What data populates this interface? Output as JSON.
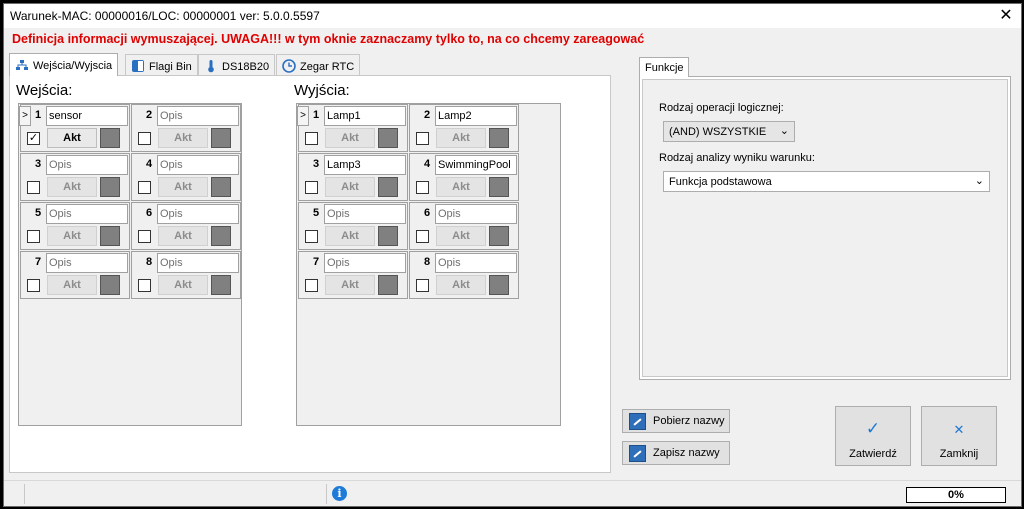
{
  "window": {
    "title": "Warunek-MAC: 00000016/LOC: 00000001 ver: 5.0.0.5597",
    "close_glyph": "✕"
  },
  "warning": "Definicja informacji wymuszającej. UWAGA!!! w tym oknie zaznaczamy tylko to, na co chcemy zareagować",
  "tabs": [
    {
      "label": "Wejścia/Wyjscia",
      "icon": "network-icon",
      "active": true
    },
    {
      "label": "Flagi Bin",
      "icon": "flag-icon",
      "active": false
    },
    {
      "label": "DS18B20",
      "icon": "thermometer-icon",
      "active": false
    },
    {
      "label": "Zegar RTC",
      "icon": "clock-icon",
      "active": false
    }
  ],
  "inputs": {
    "label": "Wejścia:",
    "akt_label": "Akt",
    "slots": [
      {
        "n": "1",
        "name": "sensor",
        "placeholder": false,
        "checked": true,
        "akt_active": true,
        "cursor": ">"
      },
      {
        "n": "2",
        "name": "Opis",
        "placeholder": true,
        "checked": false,
        "akt_active": false
      },
      {
        "n": "3",
        "name": "Opis",
        "placeholder": true,
        "checked": false,
        "akt_active": false
      },
      {
        "n": "4",
        "name": "Opis",
        "placeholder": true,
        "checked": false,
        "akt_active": false
      },
      {
        "n": "5",
        "name": "Opis",
        "placeholder": true,
        "checked": false,
        "akt_active": false
      },
      {
        "n": "6",
        "name": "Opis",
        "placeholder": true,
        "checked": false,
        "akt_active": false
      },
      {
        "n": "7",
        "name": "Opis",
        "placeholder": true,
        "checked": false,
        "akt_active": false
      },
      {
        "n": "8",
        "name": "Opis",
        "placeholder": true,
        "checked": false,
        "akt_active": false
      }
    ]
  },
  "outputs": {
    "label": "Wyjścia:",
    "akt_label": "Akt",
    "slots": [
      {
        "n": "1",
        "name": "Lamp1",
        "placeholder": false,
        "checked": false,
        "akt_active": false,
        "cursor": ">"
      },
      {
        "n": "2",
        "name": "Lamp2",
        "placeholder": false,
        "checked": false,
        "akt_active": false
      },
      {
        "n": "3",
        "name": "Lamp3",
        "placeholder": false,
        "checked": false,
        "akt_active": false
      },
      {
        "n": "4",
        "name": "SwimmingPool",
        "placeholder": false,
        "checked": false,
        "akt_active": false
      },
      {
        "n": "5",
        "name": "Opis",
        "placeholder": true,
        "checked": false,
        "akt_active": false
      },
      {
        "n": "6",
        "name": "Opis",
        "placeholder": true,
        "checked": false,
        "akt_active": false
      },
      {
        "n": "7",
        "name": "Opis",
        "placeholder": true,
        "checked": false,
        "akt_active": false
      },
      {
        "n": "8",
        "name": "Opis",
        "placeholder": true,
        "checked": false,
        "akt_active": false
      }
    ]
  },
  "functions": {
    "tab_label": "Funkcje",
    "logic_label": "Rodzaj operacji logicznej:",
    "logic_value": "(AND) WSZYSTKIE",
    "analysis_label": "Rodzaj analizy wyniku warunku:",
    "analysis_value": "Funkcja podstawowa",
    "arrow_glyph": "⌄"
  },
  "buttons": {
    "fetch_names": "Pobierz nazwy",
    "save_names": "Zapisz nazwy",
    "confirm": "Zatwierdź",
    "close": "Zamknij",
    "confirm_glyph": "✓",
    "close_glyph": "✕"
  },
  "status": {
    "info_glyph": "i",
    "progress_text": "0%",
    "progress_value": 0
  }
}
